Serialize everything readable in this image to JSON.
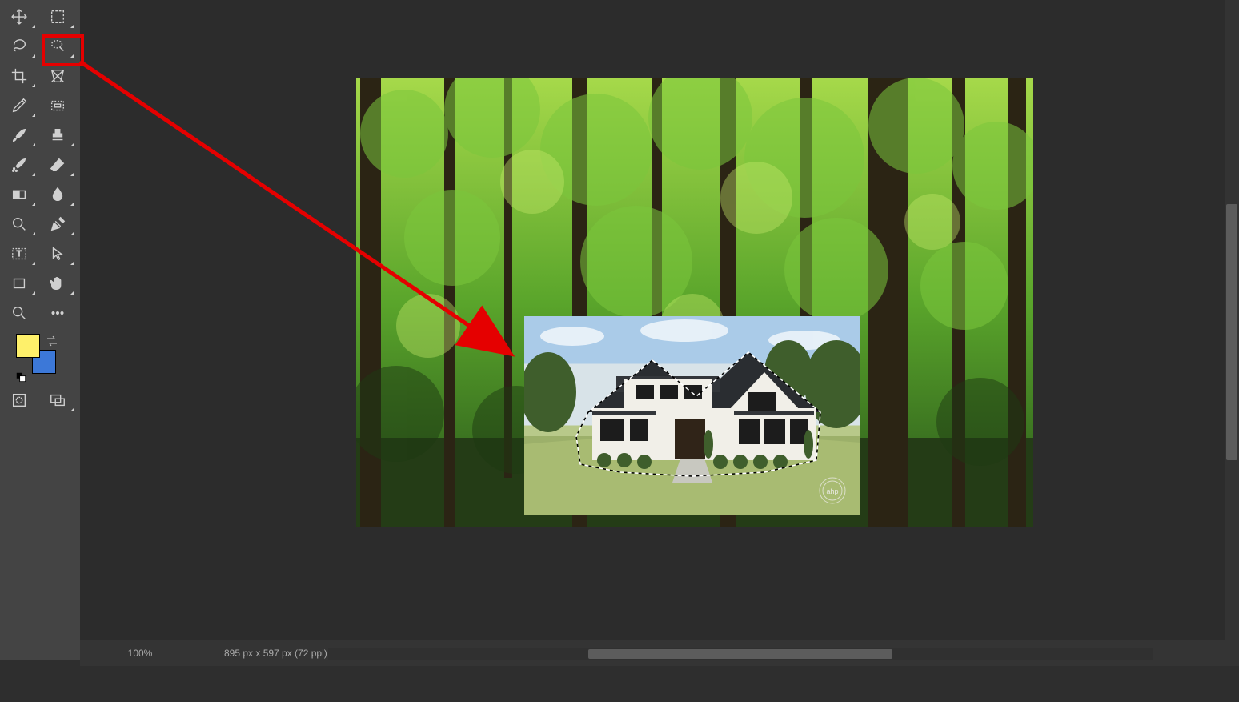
{
  "tools": {
    "row1_left": "move-tool",
    "row1_right": "rect-select-tool",
    "row2_left": "lasso-tool",
    "row2_right": "magnetic-lasso-tool",
    "row3_left": "crop-tool",
    "row3_right": "perspective-tool",
    "row4_left": "eyedropper-tool",
    "row4_right": "marquee-tool",
    "row5_left": "brush-tool",
    "row5_right": "stamp-tool",
    "row6_left": "healing-brush-tool",
    "row6_right": "eraser-tool",
    "row7_left": "gradient-tool",
    "row7_right": "blur-tool",
    "row8_left": "dodge-tool",
    "row8_right": "pen-tool",
    "row9_left": "text-tool",
    "row9_right": "path-select-tool",
    "row10_left": "shape-tool",
    "row10_right": "hand-tool",
    "row11_left": "zoom-tool",
    "row11_right": "more-tool",
    "bottom_left": "quickmask-toggle",
    "bottom_right": "screen-mode-tool"
  },
  "colors": {
    "foreground": "#fef06a",
    "background": "#3c78d8"
  },
  "status": {
    "zoom": "100%",
    "dims": "895 px x 597 px (72 ppi)"
  },
  "annotation": {
    "highlighted_tool": "magnetic-lasso-tool"
  },
  "canvas": {
    "background_desc": "forest-photo",
    "layer_desc": "house-render-with-selection",
    "watermark": "ahp"
  }
}
